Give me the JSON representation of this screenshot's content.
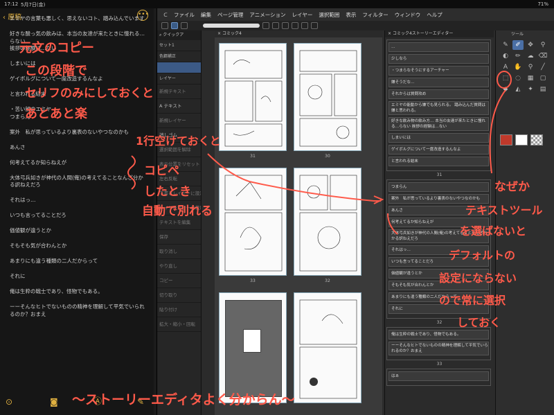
{
  "status": {
    "time": "17:12",
    "date": "5月7日(金)",
    "battery": "71%"
  },
  "notes": {
    "back_label": "原稿",
    "more_icon": "ellipsis-icon",
    "lines": [
      "エミヤの言葉も悪しく、思えないコト、踏み込んでいます",
      "好きな酸っ気の飲みは、本当の友達が来たときに憧れる…らない\n挨拶の経験は…ない",
      "しまいには",
      "ゲイボルグについて一度改造するんなよ",
      "と言われる結末",
      "・苦い顔のエミヤ\nつまらん",
      "案外　私が思っているより裏表のないやつなのかも",
      "あんさ",
      "何考えてるか知らねえが",
      "大体弓兵如きが神代の人間(俺)の考えてることなんざ分かる訳ねえだろ",
      "それはっ…",
      "いつも言ってることだろ",
      "価値観が違うとか",
      "そもそも気が合わんとか",
      "あまりにも違う種類の二人だからって",
      "それに",
      "俺は生粋の戦士であり、怪物でもある。",
      "ーーそんなヒトでないものの精神を理解して平気でいられるのか？おまえ"
    ]
  },
  "app": {
    "menu": [
      "ファイル",
      "編集",
      "ページ管理",
      "アニメーション",
      "レイヤー",
      "選択範囲",
      "表示",
      "フィルター",
      "ウィンドウ",
      "ヘルプ"
    ],
    "canvas_tab": "コミック4",
    "story_tab": "コミック4ストーリーエディター",
    "tools_header": "ツール",
    "subpanel": {
      "search_label": "クイックア",
      "set_label": "セット1",
      "tool_label": "色鋼補正",
      "layer_label": "レイヤー",
      "items": [
        "新規テキスト",
        "テキスト",
        "新規レイヤー",
        "消しゴム",
        "選択範囲を解除",
        "表示位置をリセット",
        "左右反転",
        "下書きレイヤーに設定",
        "レイヤーカラーの使用切り替え",
        "テキストを編集",
        "保存",
        "取り消し",
        "やり直し",
        "コピー",
        "切り取り",
        "貼り付け",
        "拡大・縮小・回転"
      ]
    },
    "page_numbers": [
      "31",
      "30",
      "33",
      "32"
    ],
    "story": {
      "group1": [
        "…",
        "少しなら",
        "・つまらなそうにするアーチャー",
        "嫌そうだな…",
        "それからは質問攻め",
        "エミヤの能動から嫌でも見られる。 踏み込んだ質問は嫌と思われる。",
        "好きな飲み物の飲み方… 本当の友達が来たときに憧れる…らない 挨拶の経験は…ない",
        "しまいには",
        "ゲイボルグについて一度改造するんなよ",
        "と言われる結末"
      ],
      "group1_num": "31",
      "group2": [
        "つまらん",
        "案外　私が思っているより裏表のないやつなのかも",
        "あんさ",
        "何考えてるか知らねえが",
        "大体弓兵如きが神代の人間(俺)の考えてることなんざ分かる訳ねえだろ",
        "それはっ…",
        "いつも言ってることだろ",
        "価値観が違うとか",
        "そもそも気が合わんとか",
        "あまりにも違う種類の二人だからって",
        "それに"
      ],
      "group2_num": "32",
      "group3": [
        "俺は生粋の戦士であり、怪物でもある。",
        "ーーそんなヒトでないものの精神を理解して平気でいられるのか？おまえ"
      ],
      "group3_num": "33",
      "group4": [
        "はぁ"
      ]
    }
  },
  "annotations": {
    "top_left": [
      "元文のコピー",
      "この段階で",
      "セリフのみにしておくと",
      "あとあと楽"
    ],
    "middle": "1行空けておくと",
    "copy_paste": [
      "コピペ",
      "したとき",
      "自動で別れる"
    ],
    "why": "なぜか",
    "right": [
      "テキストツール",
      "を選ばないと",
      "デフォルトの",
      "設定にならない",
      "ので常に選択",
      "しておく"
    ],
    "bottom": "〜ストーリーエディタよく分からん〜"
  },
  "colors": {
    "annotation": "#ff5a4a",
    "accent": "#e0b040",
    "selection": "#3c5a86",
    "swatch_main": "#c0392b",
    "swatch_alt": "#ffffff"
  }
}
